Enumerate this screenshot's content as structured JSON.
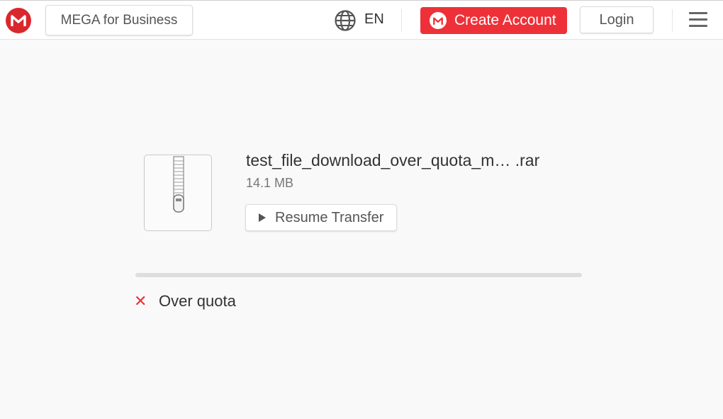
{
  "header": {
    "logo_letter": "M",
    "business_label": "MEGA for Business",
    "language": "EN",
    "create_account_label": "Create Account",
    "login_label": "Login",
    "brand_color": "#d9272e",
    "accent_color": "#ee3138"
  },
  "file": {
    "name": "test_file_download_over_quota_m…  .rar",
    "size": "14.1 MB",
    "icon": "zip-archive-icon",
    "resume_label": "Resume Transfer",
    "progress_percent": 0
  },
  "status": {
    "message": "Over quota",
    "icon": "close-icon",
    "icon_glyph": "✕"
  }
}
